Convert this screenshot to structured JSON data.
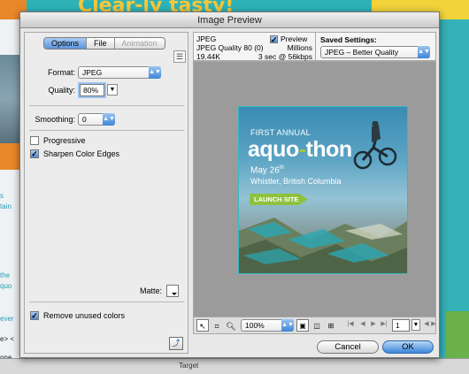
{
  "background": {
    "headline": "Clear-ly tasty!",
    "left_texts": [
      "s",
      "tain",
      "the",
      "quo",
      "ever",
      "e> <",
      "one"
    ],
    "bottom_label": "Target"
  },
  "dialog": {
    "title": "Image Preview",
    "tabs": [
      {
        "label": "Options",
        "state": "active"
      },
      {
        "label": "File",
        "state": "normal"
      },
      {
        "label": "Animation",
        "state": "disabled"
      }
    ],
    "format": {
      "label": "Format:",
      "value": "JPEG"
    },
    "quality": {
      "label": "Quality:",
      "value": "80%"
    },
    "smoothing": {
      "label": "Smoothing:",
      "value": "0"
    },
    "progressive": {
      "label": "Progressive",
      "checked": false
    },
    "sharpen": {
      "label": "Sharpen Color Edges",
      "checked": true
    },
    "matte": {
      "label": "Matte:"
    },
    "remove_unused": {
      "label": "Remove unused colors",
      "checked": true
    },
    "info": {
      "format": "JPEG",
      "quality_line": "JPEG Quality 80 (0)",
      "colors": "Millions",
      "size": "19.44K",
      "download": "3 sec @ 56kbps",
      "preview_label": "Preview",
      "preview_checked": true
    },
    "saved_settings": {
      "label": "Saved Settings:",
      "value": "JPEG – Better Quality"
    },
    "poster": {
      "line1": "FIRST ANNUAL",
      "brand_a": "aquo",
      "brand_dash": "-",
      "brand_b": "thon",
      "date": "May 26",
      "date_sup": "th",
      "location": "Whistler, British Columbia",
      "cta": "LAUNCH SITE"
    },
    "toolbar": {
      "zoom": "100%",
      "frame": "1"
    },
    "buttons": {
      "cancel": "Cancel",
      "ok": "OK"
    }
  }
}
